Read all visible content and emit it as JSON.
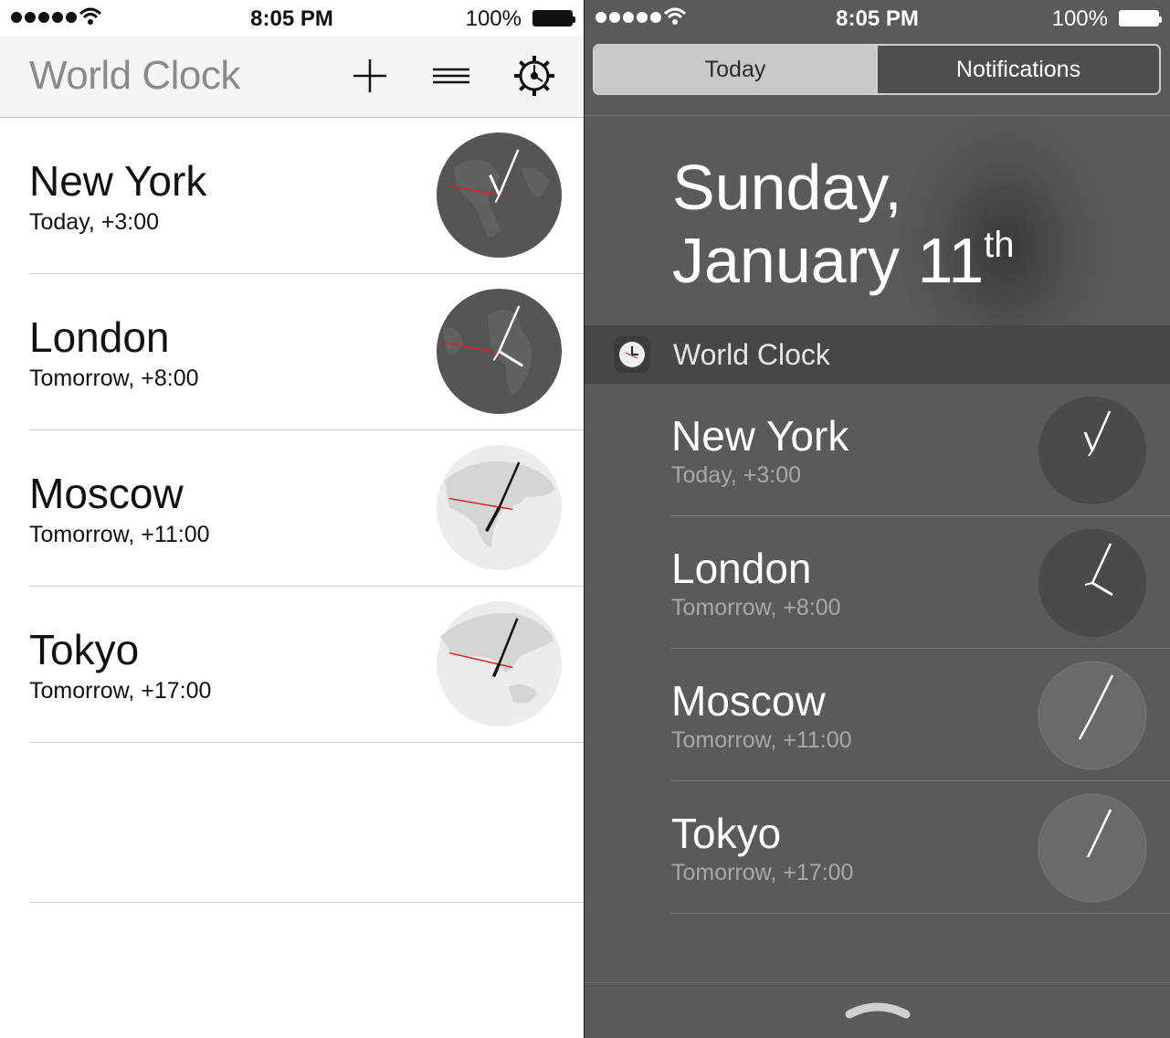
{
  "left": {
    "status": {
      "time": "8:05 PM",
      "battery": "100%"
    },
    "app_title": "World Clock",
    "toolbar": {
      "add_icon": "plus-icon",
      "menu_icon": "hamburger-icon",
      "settings_icon": "gear-icon"
    },
    "cities": [
      {
        "name": "New York",
        "sub": "Today, +3:00",
        "theme": "dark"
      },
      {
        "name": "London",
        "sub": "Tomorrow, +8:00",
        "theme": "dark"
      },
      {
        "name": "Moscow",
        "sub": "Tomorrow, +11:00",
        "theme": "light"
      },
      {
        "name": "Tokyo",
        "sub": "Tomorrow, +17:00",
        "theme": "light"
      }
    ]
  },
  "right": {
    "status": {
      "time": "8:05 PM",
      "battery": "100%"
    },
    "tabs": {
      "today": "Today",
      "notifications": "Notifications"
    },
    "date": {
      "line1": "Sunday,",
      "line2": "January 11",
      "suffix": "th"
    },
    "widget": {
      "title": "World Clock",
      "cities": [
        {
          "name": "New York",
          "sub": "Today, +3:00"
        },
        {
          "name": "London",
          "sub": "Tomorrow, +8:00"
        },
        {
          "name": "Moscow",
          "sub": "Tomorrow, +11:00"
        },
        {
          "name": "Tokyo",
          "sub": "Tomorrow, +17:00"
        }
      ]
    },
    "grabber_icon": "chevron-up-icon"
  },
  "colors": {
    "dark_globe": "#555555",
    "light_globe": "#ececec",
    "second_hand": "#e02020",
    "nc_background": "#5a5a5a"
  }
}
